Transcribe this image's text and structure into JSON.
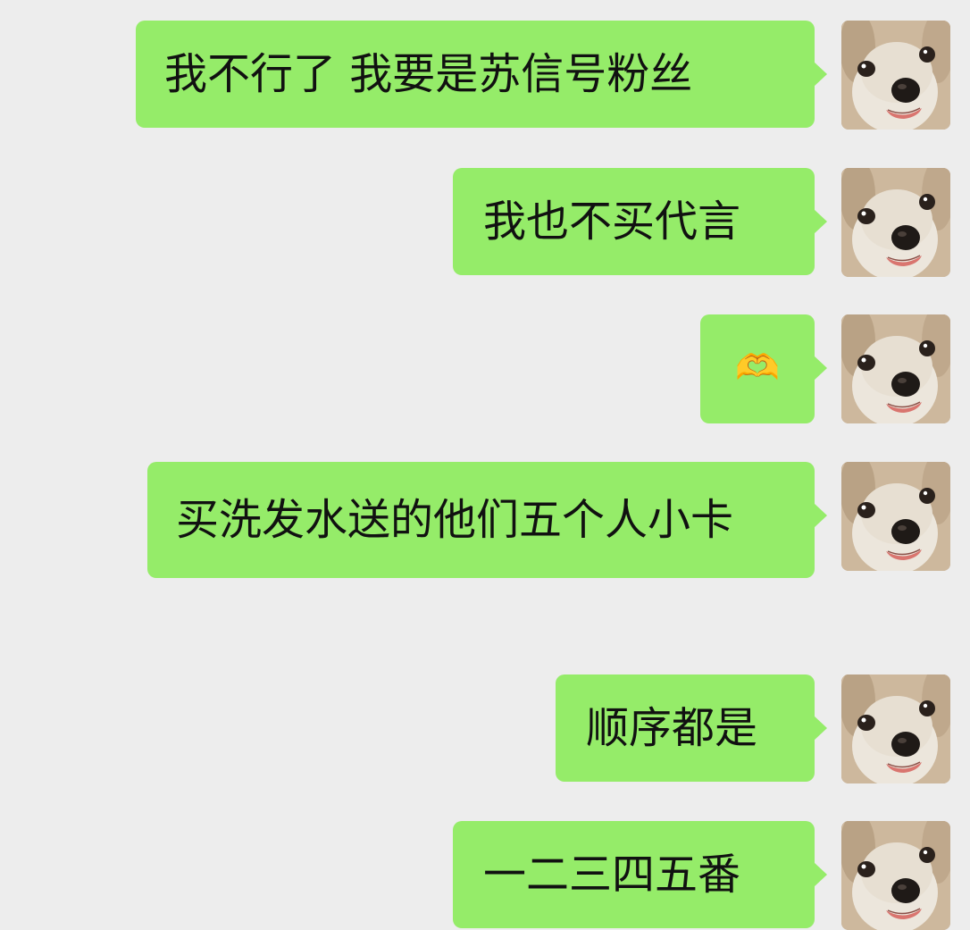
{
  "messages": [
    {
      "text": "我不行了 我要是苏信号粉丝",
      "sender": "self"
    },
    {
      "text": "我也不买代言",
      "sender": "self"
    },
    {
      "text": "🫶",
      "sender": "self"
    },
    {
      "text": "买洗发水送的他们五个人小卡",
      "sender": "self"
    },
    {
      "text": "顺序都是",
      "sender": "self"
    },
    {
      "text": "一二三四五番",
      "sender": "self"
    }
  ],
  "avatar": {
    "icon": "dog-avatar-icon",
    "description": "white puppy face"
  },
  "colors": {
    "background": "#ededed",
    "bubble": "#95ec69",
    "text": "#111111"
  }
}
